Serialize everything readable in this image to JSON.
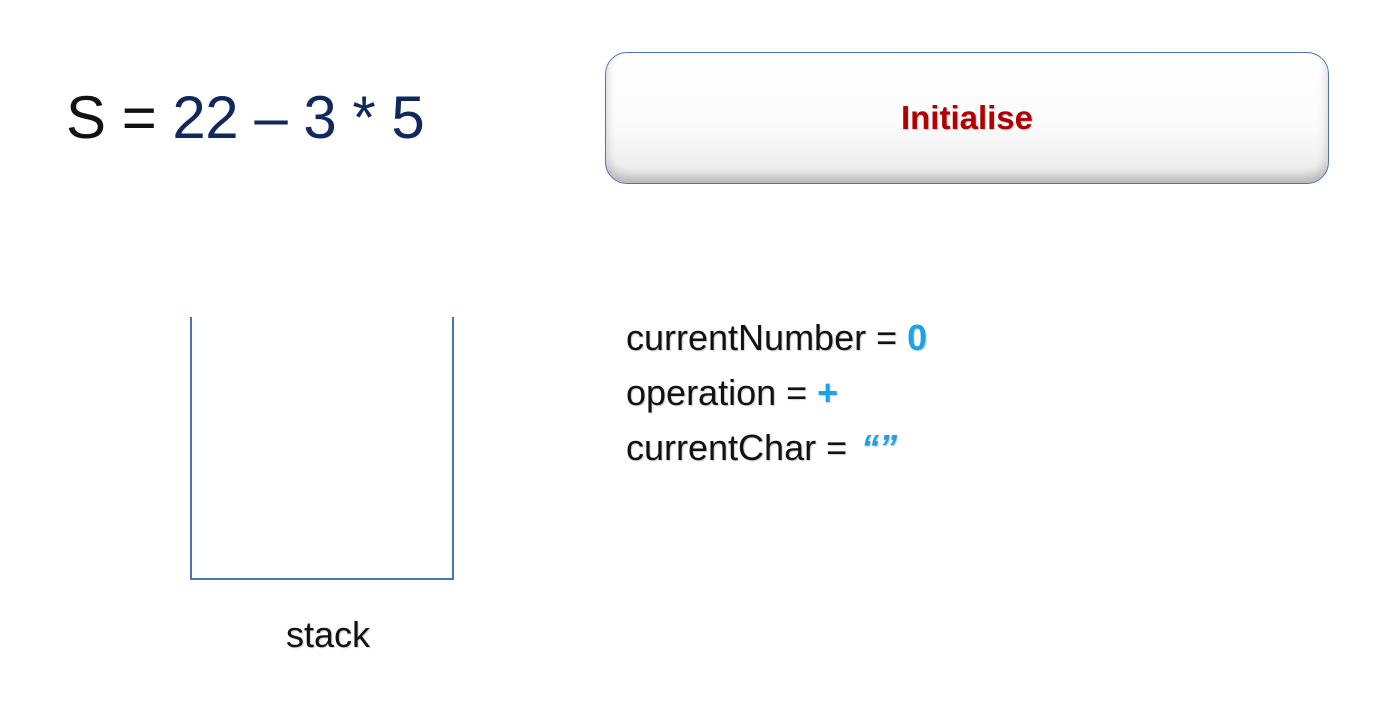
{
  "expression": {
    "lhs": "S =",
    "rhs": "22 – 3 * 5"
  },
  "banner": {
    "label": "Initialise"
  },
  "stack": {
    "label": "stack"
  },
  "variables": [
    {
      "name": "currentNumber =",
      "value": "0"
    },
    {
      "name": "operation =",
      "value": "+"
    },
    {
      "name": "currentChar =",
      "value": "“”"
    }
  ],
  "colors": {
    "expression_rhs": "#10285c",
    "banner_label": "#b00000",
    "banner_border": "#4d72b8",
    "variable_value": "#1aa3e6",
    "stack_outline": "#4d72b8"
  }
}
